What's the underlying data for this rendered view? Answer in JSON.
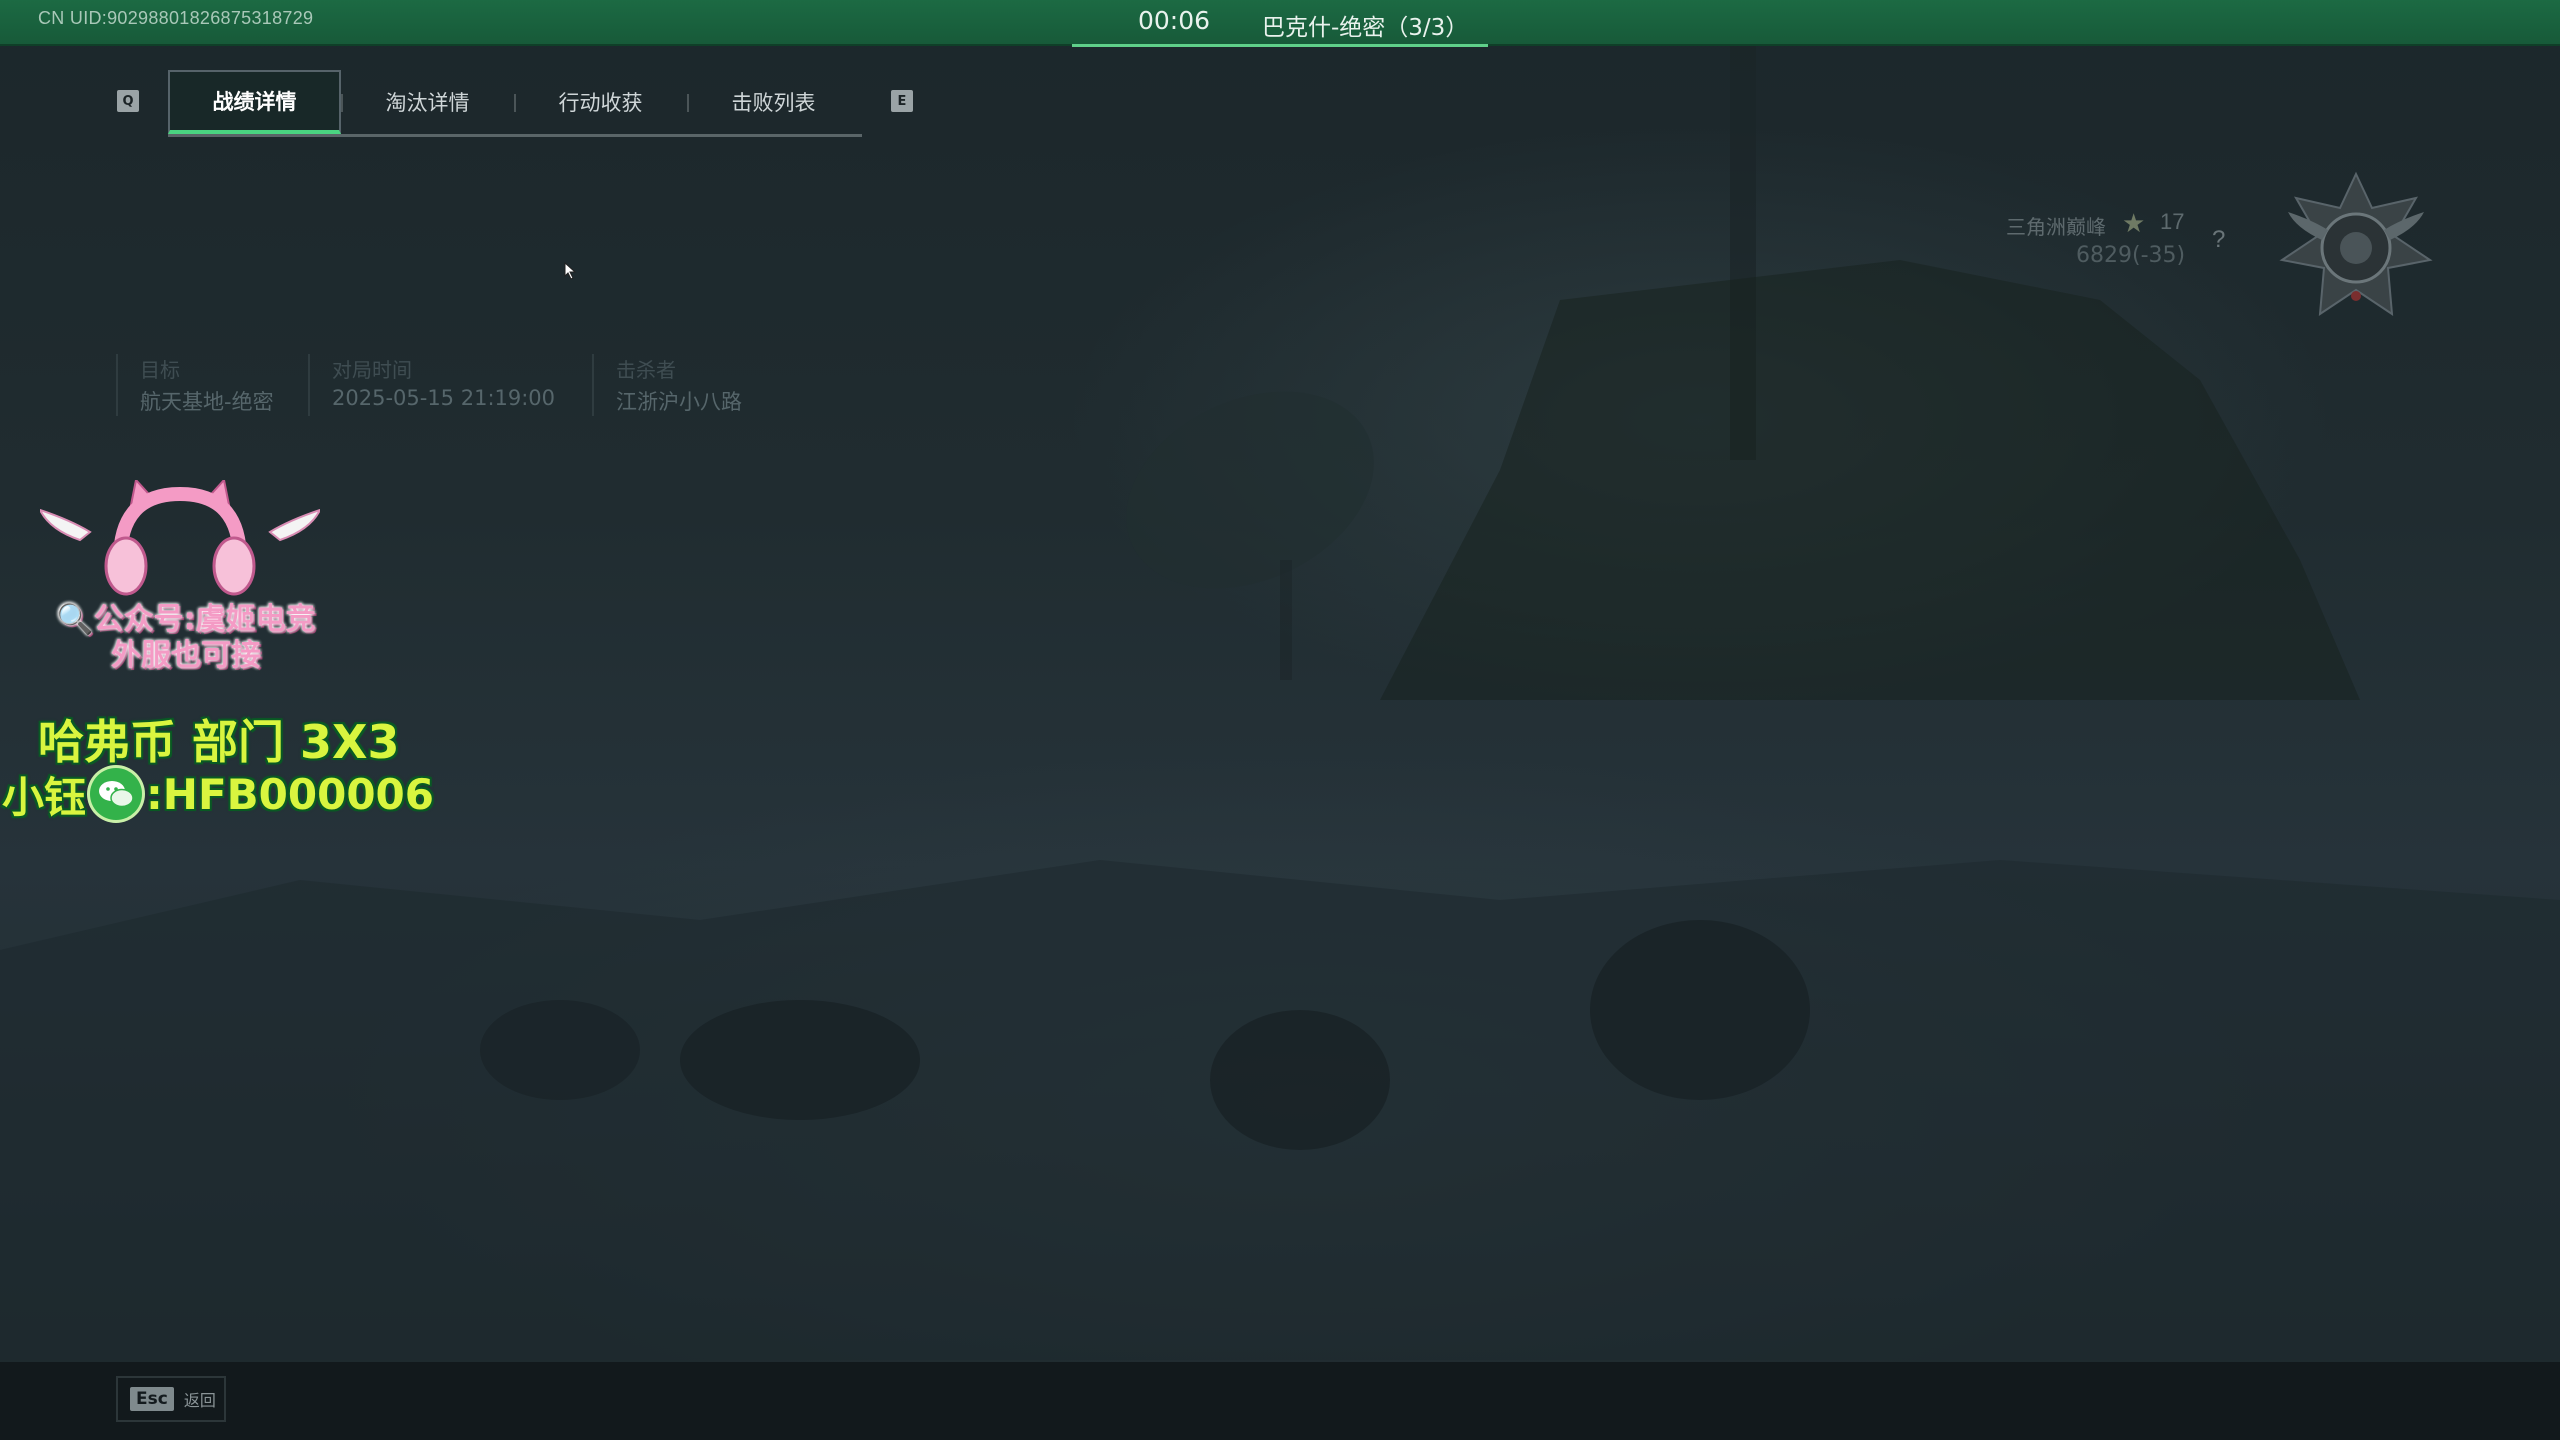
{
  "topbar": {
    "uid": "CN UID:9029880182687531872​9",
    "timer": "00:06",
    "mode": "巴克什-绝密（3/3）"
  },
  "tabs": {
    "left_key": "Q",
    "right_key": "E",
    "items": [
      {
        "label": "战绩详情",
        "active": true
      },
      {
        "label": "淘汰详情",
        "active": false
      },
      {
        "label": "行动收获",
        "active": false
      },
      {
        "label": "击败列表",
        "active": false
      }
    ]
  },
  "match_info": {
    "target_label": "目标",
    "target_value": "航天基地-绝密",
    "time_label": "对局时间",
    "time_value": "2025-05-15 21:19:00",
    "killer_label": "击杀者",
    "killer_value": "江浙沪小八路"
  },
  "rank": {
    "name": "三角洲巅峰",
    "level": "17",
    "score": "6829(-35)",
    "help": "?"
  },
  "overlay": {
    "ad_line1": "🔍公众号:虞姬电竞",
    "ad_line2": "外服也可接",
    "promo_line1": "哈弗币 部门 3X3",
    "promo_prefix": "小钰",
    "promo_id": ":HFB000006"
  },
  "bottombar": {
    "esc_key": "Esc",
    "esc_label": "返回"
  },
  "colors": {
    "topbar": "#1c6a43",
    "accent": "#4ad481",
    "promo_text": "#d9f53f",
    "ad_pink": "#f49bc5"
  }
}
